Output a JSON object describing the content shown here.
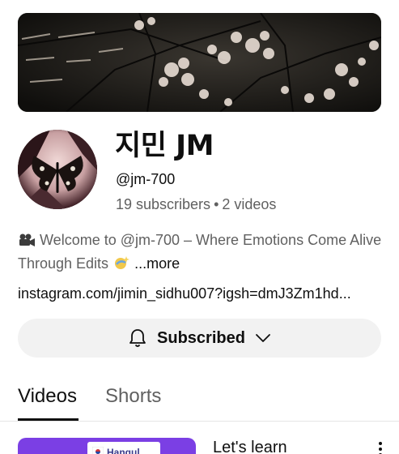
{
  "channel": {
    "name": "지민 JM",
    "handle": "@jm-700",
    "subscribers": "19 subscribers",
    "separator": "•",
    "videos_count": "2 videos"
  },
  "description": {
    "text": "Welcome to @jm-700 – Where Emotions Come Alive Through Edits",
    "more_label": "...more"
  },
  "link": {
    "text": "instagram.com/jimin_sidhu007?igsh=dmJ3Zm1hd..."
  },
  "subscribe_button": {
    "label": "Subscribed"
  },
  "tabs": [
    {
      "label": "Videos",
      "selected": true
    },
    {
      "label": "Shorts",
      "selected": false
    }
  ],
  "videos": [
    {
      "title": "Let's learn",
      "thumbnail_text": "Hangul"
    }
  ],
  "colors": {
    "text_primary": "#0f0f0f",
    "text_secondary": "#606060",
    "button_bg": "#f2f2f2",
    "thumbnail_accent": "#7b3fe4"
  },
  "icons": {
    "description_leading": "movie-camera-icon",
    "description_trailing": "sparkles-icon",
    "subscribe_leading": "bell-icon",
    "subscribe_trailing": "chevron-down-icon",
    "video_menu": "more-vert-icon"
  }
}
